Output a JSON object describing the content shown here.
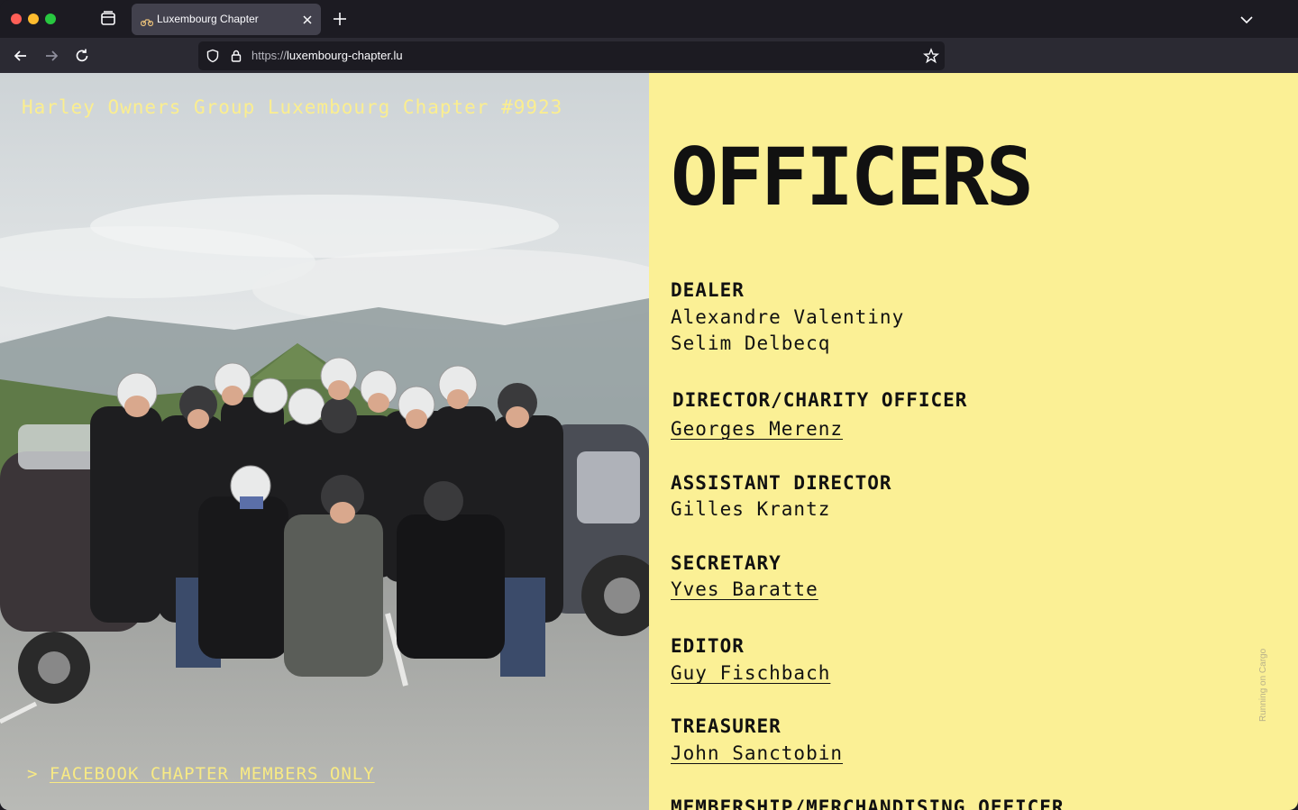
{
  "browser": {
    "tab_title": "Luxembourg Chapter",
    "url_scheme": "https://",
    "url_host": "luxembourg-chapter.lu"
  },
  "site": {
    "title": "Harley Owners Group Luxembourg Chapter #9923",
    "facebook_prefix": ">",
    "facebook_link": "FACEBOOK CHAPTER MEMBERS ONLY"
  },
  "officers": {
    "heading": "OFFICERS",
    "sections": [
      {
        "role": "DEALER",
        "names": [
          "Alexandre Valentiny",
          "Selim Delbecq"
        ]
      },
      {
        "role": "DIRECTOR/CHARITY OFFICER",
        "names": [
          "Georges Merenz"
        ]
      },
      {
        "role": "ASSISTANT DIRECTOR",
        "names": [
          "Gilles Krantz"
        ]
      },
      {
        "role": "SECRETARY",
        "names": [
          "Yves Baratte"
        ]
      },
      {
        "role": "EDITOR",
        "names": [
          "Guy Fischbach"
        ]
      },
      {
        "role": "TREASURER",
        "names": [
          "John Sanctobin"
        ]
      },
      {
        "role": "MEMBERSHIP/MERCHANDISING OFFICER",
        "names": []
      }
    ]
  },
  "footer": {
    "cargo": "Running on Cargo"
  },
  "colors": {
    "panel_yellow": "#fbf095",
    "title_yellow": "#fbee8f",
    "text_dark": "#111111",
    "chrome_dark": "#1c1b22"
  }
}
